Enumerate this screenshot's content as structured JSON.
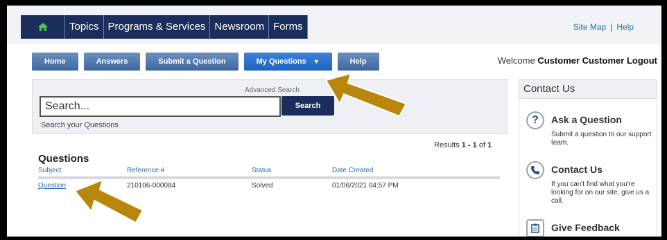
{
  "top_nav": {
    "home_icon": "home-icon",
    "tabs": [
      "Topics",
      "Programs & Services",
      "Newsroom",
      "Forms"
    ]
  },
  "top_links": {
    "site_map": "Site Map",
    "separator": "|",
    "help": "Help"
  },
  "sub_nav": {
    "items": [
      "Home",
      "Answers",
      "Submit a Question",
      "My Questions",
      "Help"
    ],
    "active": "My Questions"
  },
  "welcome": {
    "prefix": "Welcome",
    "name": "Customer Customer",
    "logout": "Logout"
  },
  "search": {
    "advanced_link": "Advanced Search",
    "placeholder": "Search...",
    "button": "Search",
    "hint": "Search your Questions"
  },
  "results": {
    "label": "Results",
    "range": "1 - 1",
    "of": "of",
    "total": "1"
  },
  "questions": {
    "heading": "Questions",
    "columns": [
      "Subject",
      "Reference #",
      "Status",
      "Date Created"
    ],
    "rows": [
      {
        "subject": "Question",
        "reference": "210106-000084",
        "status": "Solved",
        "date": "01/06/2021 04:57 PM"
      }
    ]
  },
  "sidebar": {
    "title": "Contact Us",
    "items": [
      {
        "icon": "question-icon",
        "title": "Ask a Question",
        "desc": "Submit a question to our support team."
      },
      {
        "icon": "phone-icon",
        "title": "Contact Us",
        "desc": "If you can't find what you're looking for on our site, give us a call."
      },
      {
        "icon": "clipboard-icon",
        "title": "Give Feedback",
        "desc": ""
      }
    ]
  },
  "colors": {
    "nav_dark": "#1b2d5b",
    "link": "#2a6ea8",
    "arrow": "#b8860b"
  }
}
